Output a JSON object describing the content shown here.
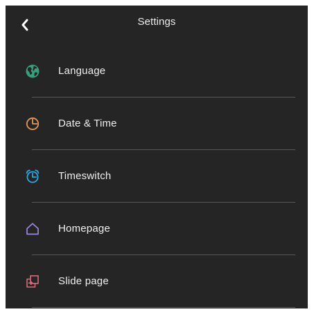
{
  "header": {
    "title": "Settings",
    "back_icon": "chevron-left-icon"
  },
  "menu": {
    "items": [
      {
        "label": "Language",
        "icon": "globe-icon",
        "color": "#35a07c"
      },
      {
        "label": "Date & Time",
        "icon": "clock-icon",
        "color": "#e99658"
      },
      {
        "label": "Timeswitch",
        "icon": "alarm-clock-icon",
        "color": "#2aa8e3"
      },
      {
        "label": "Homepage",
        "icon": "home-icon",
        "color": "#9d88e0"
      },
      {
        "label": "Slide page",
        "icon": "slide-page-icon",
        "color": "#e0677a"
      }
    ]
  },
  "colors": {
    "background": "#252525",
    "text": "#f0f0f0",
    "divider": "#5a5a5a"
  }
}
